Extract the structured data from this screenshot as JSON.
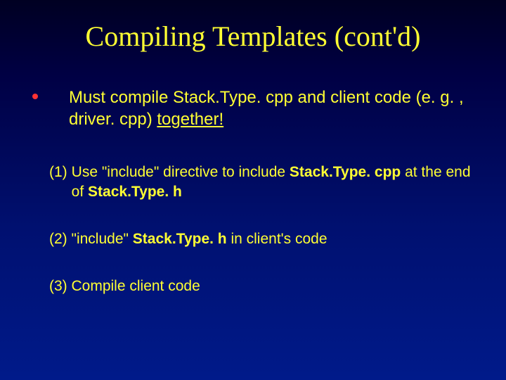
{
  "title": "Compiling Templates (cont'd)",
  "main": {
    "pre": "Must compile Stack.Type. cpp and client code (e. g. , driver. cpp) ",
    "u": "together!"
  },
  "s1": {
    "marker": "(1)",
    "t1": "Use \"include\" directive to include ",
    "b1": "Stack.Type. cpp",
    "t2": " at the end of ",
    "b2": "Stack.Type. h"
  },
  "s2": {
    "t1": "(2) \"include\" ",
    "b1": "Stack.Type. h",
    "t2": " in client's code"
  },
  "s3": {
    "t1": "(3) Compile client code"
  }
}
